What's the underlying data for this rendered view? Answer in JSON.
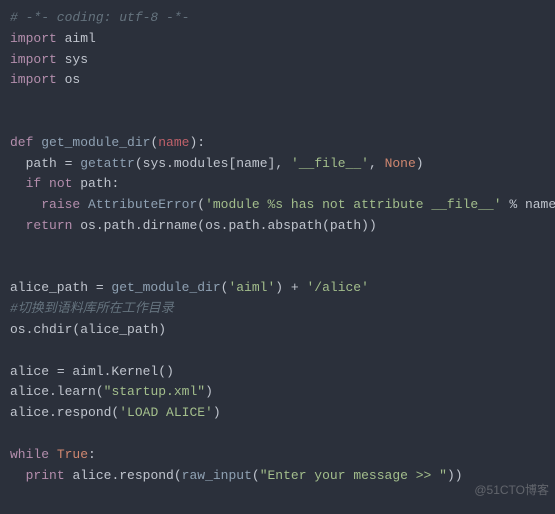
{
  "code": {
    "l1_comment": "# -*- coding: utf-8 -*-",
    "import_kw": "import",
    "mod_aiml": "aiml",
    "mod_sys": "sys",
    "mod_os": "os",
    "def_kw": "def",
    "fn_get_module_dir": "get_module_dir",
    "param_name": "name",
    "var_path": "path",
    "eq": " = ",
    "fn_getattr": "getattr",
    "sys_modules": "sys.modules",
    "str_file": "'__file__'",
    "none": "None",
    "if_kw": "if",
    "not_kw": "not",
    "colon": ":",
    "raise_kw": "raise",
    "attr_error": "AttributeError",
    "str_err": "'module %s has not attribute __file__'",
    "pct": " % ",
    "return_kw": "return",
    "os_path_dirname": "os.path.dirname",
    "os_path_abspath": "os.path.abspath",
    "var_alice_path": "alice_path",
    "str_aiml": "'aiml'",
    "plus": " + ",
    "str_alice": "'/alice'",
    "comment_cn": "#切换到语料库所在工作目录",
    "os_chdir": "os.chdir",
    "var_alice": "alice",
    "aiml_kernel": "aiml.Kernel",
    "alice_learn": "alice.learn",
    "str_startup": "\"startup.xml\"",
    "alice_respond": "alice.respond",
    "str_load": "'LOAD ALICE'",
    "while_kw": "while",
    "true": "True",
    "print_kw": "print",
    "raw_input": "raw_input",
    "str_prompt": "\"Enter your message >> \"",
    "lparen": "(",
    "rparen": ")",
    "lbrack": "[",
    "rbrack": "]",
    "comma": ", "
  },
  "watermark": "@51CTO博客"
}
